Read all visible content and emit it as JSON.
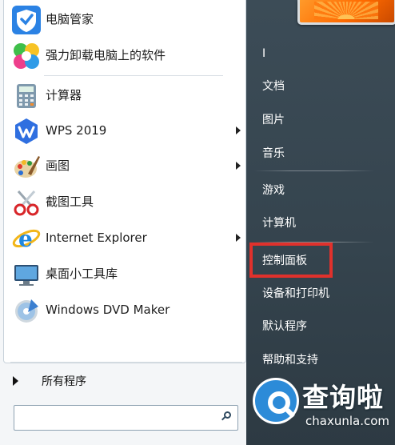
{
  "left_menu": {
    "pinned": [
      {
        "label": "电脑管家",
        "icon": "shield-icon",
        "has_submenu": false
      },
      {
        "label": "强力卸载电脑上的软件",
        "icon": "clover-icon",
        "has_submenu": false
      }
    ],
    "recent": [
      {
        "label": "计算器",
        "icon": "calculator-icon",
        "has_submenu": false
      },
      {
        "label": "WPS 2019",
        "icon": "wps-icon",
        "has_submenu": true
      },
      {
        "label": "画图",
        "icon": "paint-icon",
        "has_submenu": true
      },
      {
        "label": "截图工具",
        "icon": "scissors-icon",
        "has_submenu": false
      },
      {
        "label": "Internet Explorer",
        "icon": "ie-icon",
        "has_submenu": true
      },
      {
        "label": "桌面小工具库",
        "icon": "gadgets-icon",
        "has_submenu": false
      },
      {
        "label": "Windows DVD Maker",
        "icon": "dvd-maker-icon",
        "has_submenu": false
      }
    ],
    "all_programs": "所有程序"
  },
  "search": {
    "placeholder": "",
    "value": ""
  },
  "right_menu": {
    "items": [
      {
        "label": "I"
      },
      {
        "label": "文档"
      },
      {
        "label": "图片"
      },
      {
        "label": "音乐"
      },
      {
        "label": "游戏"
      },
      {
        "label": "计算机"
      },
      {
        "label": "控制面板",
        "highlighted": true
      },
      {
        "label": "设备和打印机"
      },
      {
        "label": "默认程序"
      },
      {
        "label": "帮助和支持"
      }
    ]
  },
  "watermark": {
    "title": "查询啦",
    "domain": "chaxunla.com"
  },
  "colors": {
    "highlight": "#e0312c",
    "right_pane": "#3c4c57",
    "brand_blue": "#2c8bd8"
  }
}
